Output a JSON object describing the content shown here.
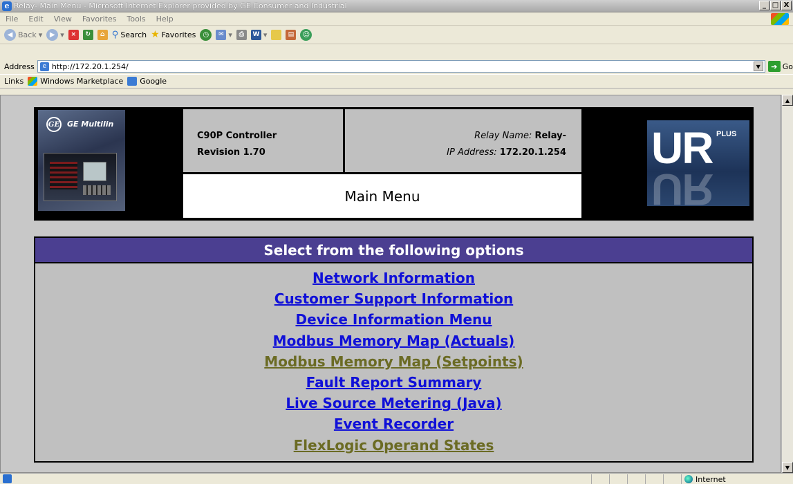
{
  "window": {
    "title": "Relay- Main Menu - Microsoft Internet Explorer provided by GE Consumer and Industrial",
    "minimize": "_",
    "maximize": "□",
    "close": "X"
  },
  "menu": [
    "File",
    "Edit",
    "View",
    "Favorites",
    "Tools",
    "Help"
  ],
  "toolbar": {
    "back": "Back",
    "search": "Search",
    "favorites": "Favorites"
  },
  "address": {
    "label": "Address",
    "url": "http://172.20.1.254/",
    "go": "Go"
  },
  "links": {
    "label": "Links",
    "items": [
      "Windows Marketplace",
      "Google"
    ]
  },
  "header": {
    "brand": "GE Multilin",
    "model": "C90P Controller",
    "revision": "Revision 1.70",
    "relay_name_label": "Relay Name:",
    "relay_name": "Relay-",
    "ip_label": "IP Address:",
    "ip": "172.20.1.254",
    "page_title": "Main Menu",
    "logo_main": "UR",
    "logo_plus": "PLUS"
  },
  "options": {
    "heading": "Select from the following options",
    "items": [
      {
        "label": "Network Information",
        "visited": false
      },
      {
        "label": "Customer Support Information",
        "visited": false
      },
      {
        "label": "Device Information Menu",
        "visited": false
      },
      {
        "label": "Modbus Memory Map (Actuals)",
        "visited": false
      },
      {
        "label": "Modbus Memory Map (Setpoints)",
        "visited": true
      },
      {
        "label": "Fault Report Summary",
        "visited": false
      },
      {
        "label": "Live Source Metering (Java)",
        "visited": false
      },
      {
        "label": "Event Recorder",
        "visited": false
      },
      {
        "label": "FlexLogic Operand States",
        "visited": true
      }
    ]
  },
  "status": {
    "zone": "Internet"
  },
  "colors": {
    "link_unvisited": "#1010d8",
    "link_visited": "#6b6b24",
    "options_header": "#4b3f91"
  }
}
